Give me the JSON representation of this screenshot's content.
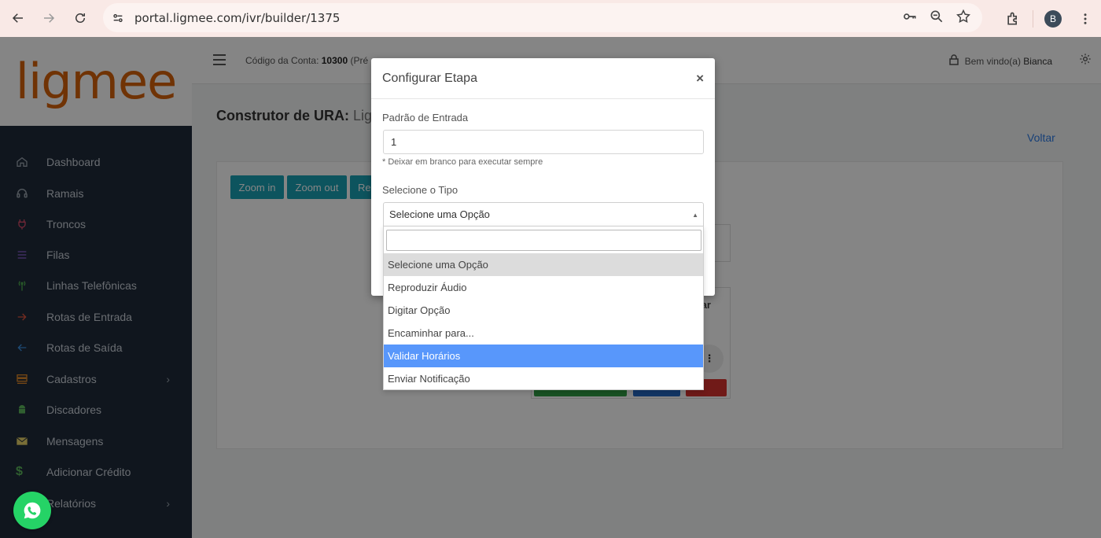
{
  "browser": {
    "url": "portal.ligmee.com/ivr/builder/1375",
    "profile_initial": "B"
  },
  "brand": {
    "logo_text": "ligmee"
  },
  "colors": {
    "brand_orange": "#d6620a",
    "sidebar_bg": "#1f2b3a",
    "teal": "#1aa1b4",
    "highlight": "#5897fb",
    "link": "#2c7be5"
  },
  "sidebar": {
    "items": [
      {
        "label": "Dashboard",
        "icon": "home-icon"
      },
      {
        "label": "Ramais",
        "icon": "headset-icon"
      },
      {
        "label": "Troncos",
        "icon": "plug-icon"
      },
      {
        "label": "Filas",
        "icon": "list-icon"
      },
      {
        "label": "Linhas Telefônicas",
        "icon": "antenna-icon"
      },
      {
        "label": "Rotas de Entrada",
        "icon": "arrow-right-icon"
      },
      {
        "label": "Rotas de Saída",
        "icon": "arrow-left-icon"
      },
      {
        "label": "Cadastros",
        "icon": "database-icon",
        "chevron": "›"
      },
      {
        "label": "Discadores",
        "icon": "android-icon"
      },
      {
        "label": "Mensagens",
        "icon": "envelope-icon"
      },
      {
        "label": "Adicionar Crédito",
        "icon": "dollar-icon"
      },
      {
        "label": "Relatórios",
        "icon": "chart-icon",
        "chevron": "›"
      }
    ]
  },
  "topbar": {
    "account_label": "Código da Conta:",
    "account_number": "10300",
    "account_suffix": "(Pré",
    "welcome_label": "Bem vindo(a)",
    "user_name": "Bianca"
  },
  "main": {
    "title_bold": "Construtor de URA:",
    "title_rest": "Lig",
    "back_link": "Voltar",
    "zoom_in": "Zoom in",
    "zoom_out": "Zoom out",
    "reset": "Res",
    "node_text": "ar",
    "node_menu": "⋮"
  },
  "modal": {
    "title": "Configurar Etapa",
    "close": "×",
    "pattern_label": "Padrão de Entrada",
    "pattern_value": "1",
    "pattern_hint": "* Deixar em branco para executar sempre",
    "type_label": "Selecione o Tipo",
    "type_selected": "Selecione uma Opção"
  },
  "dropdown": {
    "search_value": "",
    "options": [
      {
        "label": "Selecione uma Opção",
        "state": "selected"
      },
      {
        "label": "Reproduzir Áudio",
        "state": ""
      },
      {
        "label": "Digitar Opção",
        "state": ""
      },
      {
        "label": "Encaminhar para...",
        "state": ""
      },
      {
        "label": "Validar Horários",
        "state": "highlighted"
      },
      {
        "label": "Enviar Notificação",
        "state": ""
      }
    ]
  }
}
